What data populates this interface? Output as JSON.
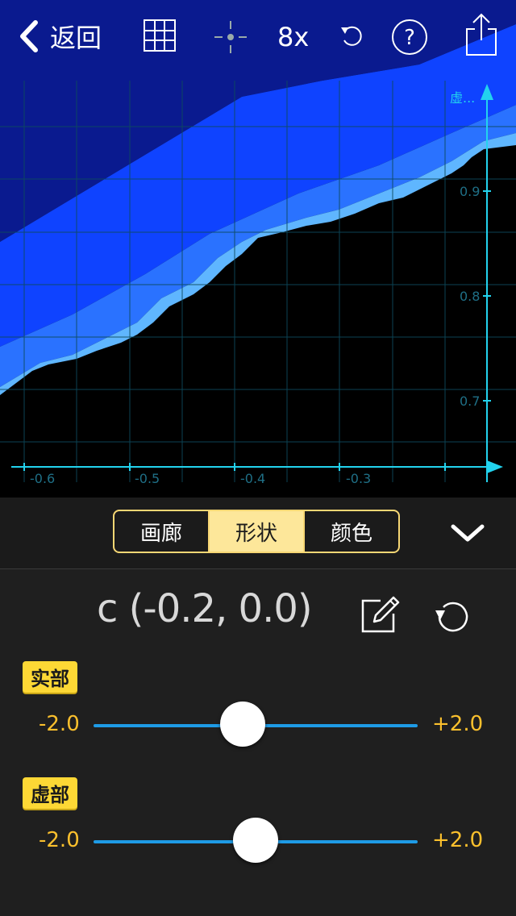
{
  "toolbar": {
    "back_label": "返回",
    "zoom_label": "8x",
    "icons": [
      "chevron-left-icon",
      "grid-icon",
      "crosshair-icon",
      "undo-icon",
      "help-icon",
      "share-icon"
    ]
  },
  "plot": {
    "y_axis_name": "虚...",
    "x_ticks": [
      "-0.6",
      "-0.5",
      "-0.4",
      "-0.3"
    ],
    "y_ticks": [
      "0.9",
      "0.8",
      "0.7"
    ],
    "colors": {
      "axis": "#22d3ee",
      "grid": "#0e3a4a",
      "fill_dark": "#0a2cff",
      "fill_mid": "#2a6bff",
      "fill_light": "#6fc3ff"
    }
  },
  "tabs": {
    "items": [
      "画廊",
      "形状",
      "颜色"
    ],
    "active": "形状"
  },
  "param": {
    "label": "c (-0.2, 0.0)"
  },
  "sliders": [
    {
      "tag": "实部",
      "min_label": "-2.0",
      "max_label": "+2.0",
      "value": 0.0,
      "range": [
        -2.0,
        2.0
      ]
    },
    {
      "tag": "虚部",
      "min_label": "-2.0",
      "max_label": "+2.0",
      "value": 0.0,
      "range": [
        -2.0,
        2.0
      ]
    }
  ],
  "colors": {
    "accent": "#fdd835",
    "segment_border": "#f7d774",
    "segment_active": "#fde79a",
    "track": "#1e9be6",
    "panel_bg": "#1f1f1f"
  }
}
